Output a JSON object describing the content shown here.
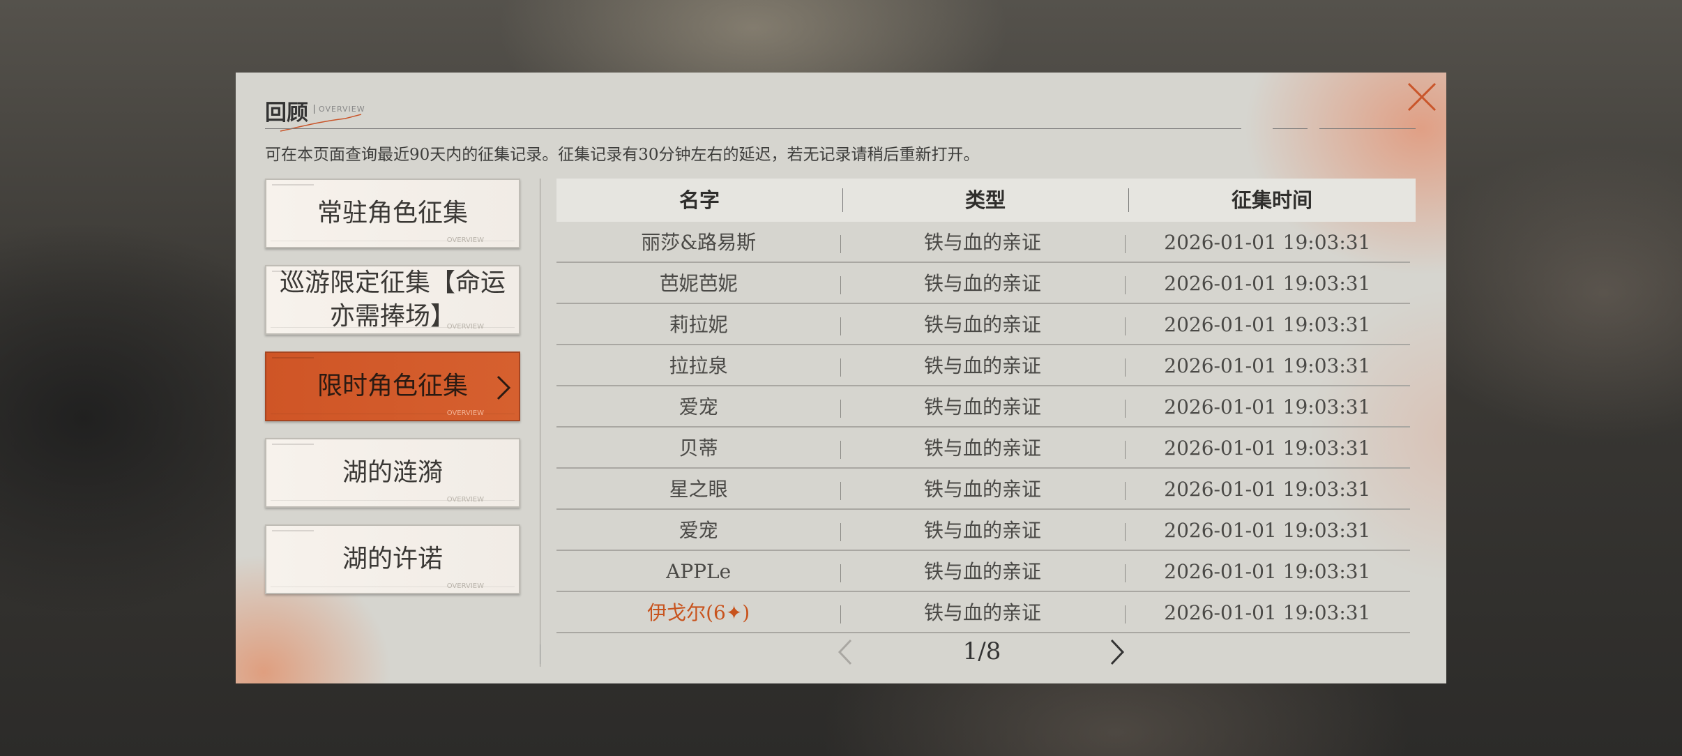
{
  "header": {
    "title": "回顾",
    "subtitle": "OVERVIEW",
    "notice": "可在本页面查询最近90天内的征集记录。征集记录有30分钟左右的延迟，若无记录请稍后重新打开。"
  },
  "nav": {
    "items": [
      {
        "label": "常驻角色征集",
        "deco": "OVERVIEW"
      },
      {
        "label": "巡游限定征集【命运亦需捧场】",
        "deco": "OVERVIEW"
      },
      {
        "label": "限时角色征集",
        "deco": "OVERVIEW"
      },
      {
        "label": "湖的涟漪",
        "deco": "OVERVIEW"
      },
      {
        "label": "湖的许诺",
        "deco": "OVERVIEW"
      }
    ],
    "active_index": 2
  },
  "table": {
    "headers": {
      "name": "名字",
      "type": "类型",
      "time": "征集时间"
    },
    "rows": [
      {
        "name": "丽莎&路易斯",
        "type": "铁与血的亲证",
        "time": "2026-01-01 19:03:31"
      },
      {
        "name": "芭妮芭妮",
        "type": "铁与血的亲证",
        "time": "2026-01-01 19:03:31"
      },
      {
        "name": "莉拉妮",
        "type": "铁与血的亲证",
        "time": "2026-01-01 19:03:31"
      },
      {
        "name": "拉拉泉",
        "type": "铁与血的亲证",
        "time": "2026-01-01 19:03:31"
      },
      {
        "name": "爱宠",
        "type": "铁与血的亲证",
        "time": "2026-01-01 19:03:31"
      },
      {
        "name": "贝蒂",
        "type": "铁与血的亲证",
        "time": "2026-01-01 19:03:31"
      },
      {
        "name": "星之眼",
        "type": "铁与血的亲证",
        "time": "2026-01-01 19:03:31"
      },
      {
        "name": "爱宠",
        "type": "铁与血的亲证",
        "time": "2026-01-01 19:03:31"
      },
      {
        "name": "APPLe",
        "type": "铁与血的亲证",
        "time": "2026-01-01 19:03:31"
      },
      {
        "name": "伊戈尔(6✦)",
        "type": "铁与血的亲证",
        "time": "2026-01-01 19:03:31",
        "highlight": true
      }
    ]
  },
  "pager": {
    "label": "1/8"
  },
  "colors": {
    "accent": "#d05a2a",
    "highlight_text": "#c8531d",
    "panel_bg": "#d6d5cf"
  },
  "icons": {
    "close": "close-icon",
    "prev": "chevron-left-icon",
    "next": "chevron-right-icon",
    "active_nav": "chevron-right-icon"
  }
}
